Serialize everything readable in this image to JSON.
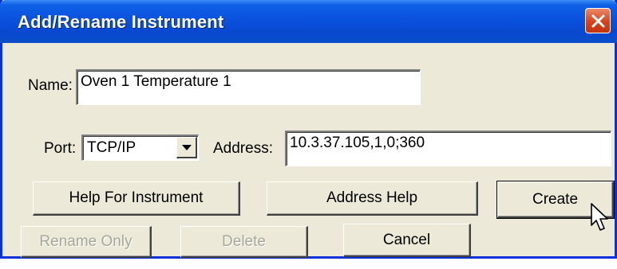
{
  "window": {
    "title": "Add/Rename Instrument",
    "close_icon": "close-icon"
  },
  "name": {
    "label": "Name:",
    "value": "Oven 1 Temperature 1"
  },
  "port": {
    "label": "Port:",
    "selected": "TCP/IP"
  },
  "address": {
    "label": "Address:",
    "value": "10.3.37.105,1,0;360"
  },
  "buttons": {
    "help_for_instrument": "Help For Instrument",
    "address_help": "Address Help",
    "create": "Create",
    "rename_only": "Rename Only",
    "delete": "Delete",
    "cancel": "Cancel"
  },
  "colors": {
    "title_bar": "#0a52de",
    "close_button": "#d8431b",
    "dialog_face": "#ece9d8"
  }
}
